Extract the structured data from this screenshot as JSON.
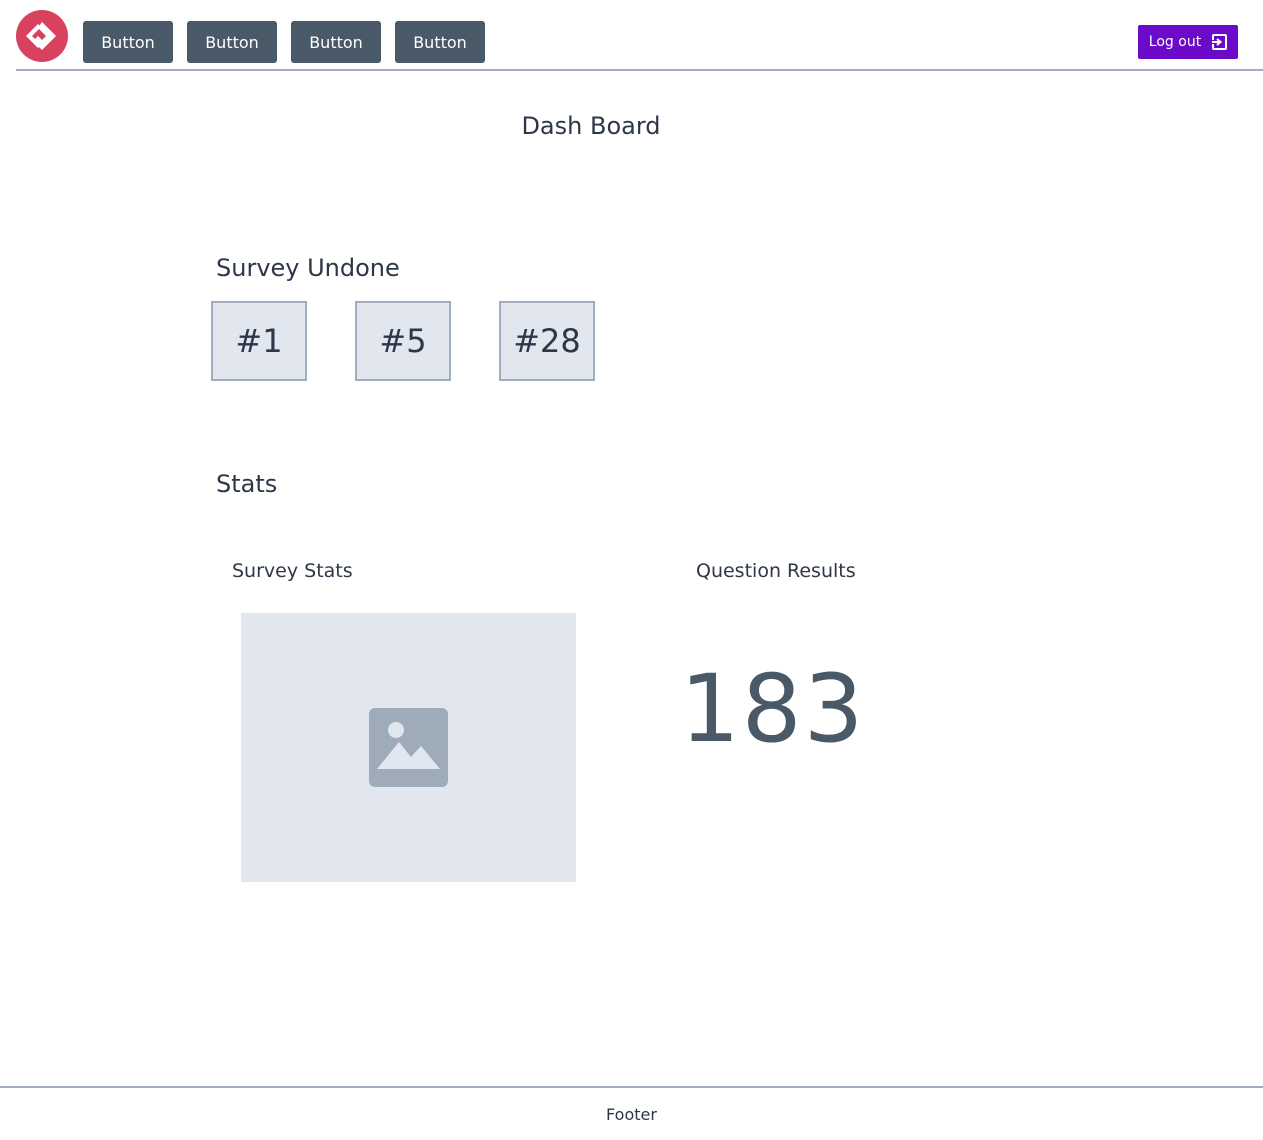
{
  "header": {
    "logo_icon": "logo-icon",
    "nav_buttons": [
      "Button",
      "Button",
      "Button",
      "Button"
    ],
    "logout_label": "Log out",
    "logout_icon": "logout-icon",
    "accent_color": "#6b0ac9",
    "logo_color": "#d8425e",
    "nav_color": "#4a5968"
  },
  "main": {
    "title": "Dash Board",
    "survey_undone": {
      "title": "Survey Undone",
      "items": [
        "#1",
        "#5",
        "#28"
      ]
    },
    "stats": {
      "title": "Stats",
      "survey_stats_title": "Survey Stats",
      "survey_stats_icon": "image-placeholder-icon",
      "question_results_title": "Question Results",
      "question_results_value": "183"
    }
  },
  "footer": {
    "text": "Footer"
  }
}
